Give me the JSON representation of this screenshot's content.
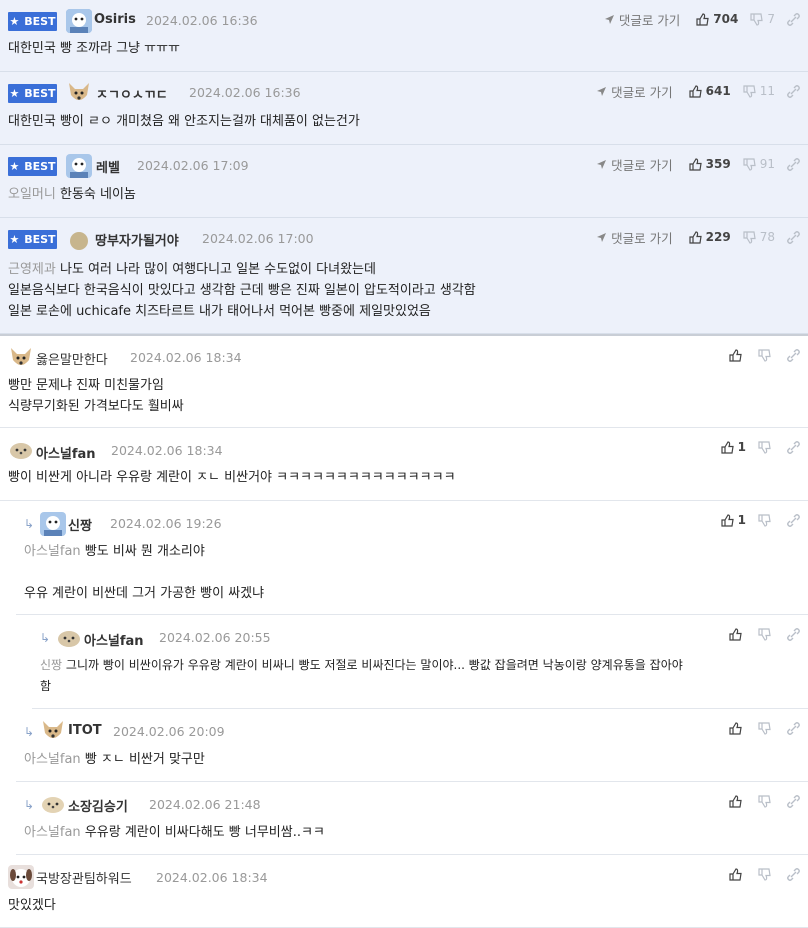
{
  "best_label": "BEST",
  "goto_label": "댓글로 가기",
  "best": [
    {
      "nick": "Osiris",
      "date": "2024.02.06 16:36",
      "up": "704",
      "down": "7",
      "lines": [
        "대한민국 빵 조까라 그냥 ㅠㅠㅠ"
      ]
    },
    {
      "nick": "ㅈㄱㅇㅅㄲㄷ",
      "date": "2024.02.06 16:36",
      "up": "641",
      "down": "11",
      "lines": [
        "대한민국 빵이 ㄹㅇ 개미쳤음 왜 안조지는걸까 대체품이 없는건가"
      ]
    },
    {
      "nick": "레벨",
      "date": "2024.02.06 17:09",
      "up": "359",
      "down": "91",
      "ref": "오일머니",
      "lines": [
        "한동숙 네이놈"
      ]
    },
    {
      "nick": "땅부자가될거야",
      "date": "2024.02.06 17:00",
      "up": "229",
      "down": "78",
      "ref": "근영제과",
      "lines": [
        "나도 여러 나라 많이 여행다니고 일본 수도없이 다녀왔는데",
        "일본음식보다 한국음식이 맛있다고 생각함 근데 빵은 진짜 일본이 압도적이라고 생각함",
        "일본 로손에 uchicafe 치즈타르트 내가 태어나서 먹어본 빵중에 제일맛있었음"
      ]
    }
  ],
  "comments": [
    {
      "nick": "옳은말만한다",
      "date": "2024.02.06 18:34",
      "up": "",
      "lines": [
        "빵만 문제냐 진짜 미친물가임",
        "식량무기화된 가격보다도 훨비싸"
      ]
    },
    {
      "nick": "아스널fan",
      "date": "2024.02.06 18:34",
      "up": "1",
      "lines": [
        "빵이 비싼게 아니라 우유랑 계란이 ㅈㄴ 비싼거야 ㅋㅋㅋㅋㅋㅋㅋㅋㅋㅋㅋㅋㅋㅋㅋ"
      ]
    },
    {
      "nick": "신짱",
      "date": "2024.02.06 19:26",
      "up": "1",
      "ref": "아스널fan",
      "lines": [
        "빵도 비싸 뭔 개소리야",
        "",
        "우유 계란이 비싼데 그거 가공한 빵이 싸겠냐"
      ]
    },
    {
      "nick": "아스널fan",
      "date": "2024.02.06 20:55",
      "up": "",
      "ref": "신짱",
      "lines": [
        "그니까 빵이 비싼이유가 우유랑 계란이 비싸니 빵도 저절로 비싸진다는 말이야... 빵값 잡을려면 낙농이랑 양계유통을 잡아야",
        "함"
      ]
    },
    {
      "nick": "ITOT",
      "date": "2024.02.06 20:09",
      "up": "",
      "ref": "아스널fan",
      "lines": [
        "빵 ㅈㄴ 비싼거 맞구만"
      ]
    },
    {
      "nick": "소장김승기",
      "date": "2024.02.06 21:48",
      "up": "",
      "ref": "아스널fan",
      "lines": [
        "우유랑 계란이 비싸다해도 빵 너무비쌈..ㅋㅋ"
      ]
    },
    {
      "nick": "국방장관팀하워드",
      "date": "2024.02.06 18:34",
      "up": "",
      "lines": [
        "맛있겠다"
      ]
    }
  ]
}
